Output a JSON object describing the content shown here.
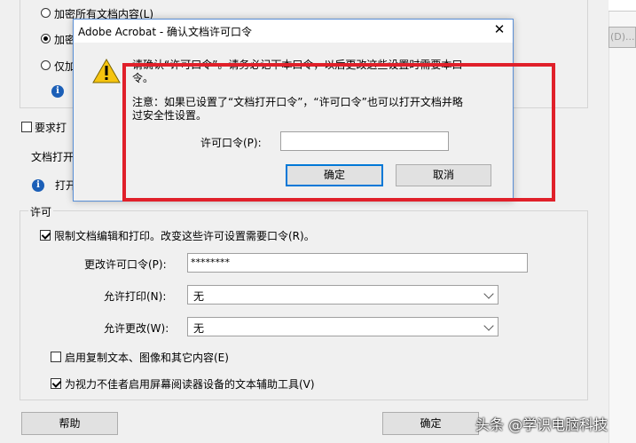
{
  "bg": {
    "radio_encrypt_all": "加密所有文档内容(L)",
    "radio_encrypt_partial": "加密",
    "radio_only": "仅加",
    "require_open_pw": "要求打",
    "doc_open_label": "文档打开",
    "open_info": "打开",
    "right_cut_text": "(D)..."
  },
  "permissions": {
    "group_title": "许可",
    "restrict_label": "限制文档编辑和打印。改变这些许可设置需要口令(R)。",
    "change_pw_label": "更改许可口令(P):",
    "change_pw_value": "********",
    "allow_print_label": "允许打印(N):",
    "allow_print_value": "无",
    "allow_change_label": "允许更改(W):",
    "allow_change_value": "无",
    "enable_copy_label": "启用复制文本、图像和其它内容(E)",
    "accessibility_label": "为视力不佳者启用屏幕阅读器设备的文本辅助工具(V)"
  },
  "footer": {
    "help_label": "帮助",
    "ok_label": "确定",
    "watermark": "头条 @学识电脑科技"
  },
  "dialog": {
    "title": "Adobe Acrobat - 确认文档许可口令",
    "msg_line1": "请确认“许可口令”。请务必记下本口令，以后更改这些设置时需要本口",
    "msg_line2": "令。",
    "note_line1": "注意：如果已设置了“文档打开口令”，“许可口令”也可以打开文档并略",
    "note_line2": "过安全性设置。",
    "pw_label": "许可口令(P):",
    "pw_value": "",
    "ok_label": "确定",
    "cancel_label": "取消"
  },
  "colors": {
    "highlight": "#e0202a",
    "accent": "#0078d7"
  }
}
